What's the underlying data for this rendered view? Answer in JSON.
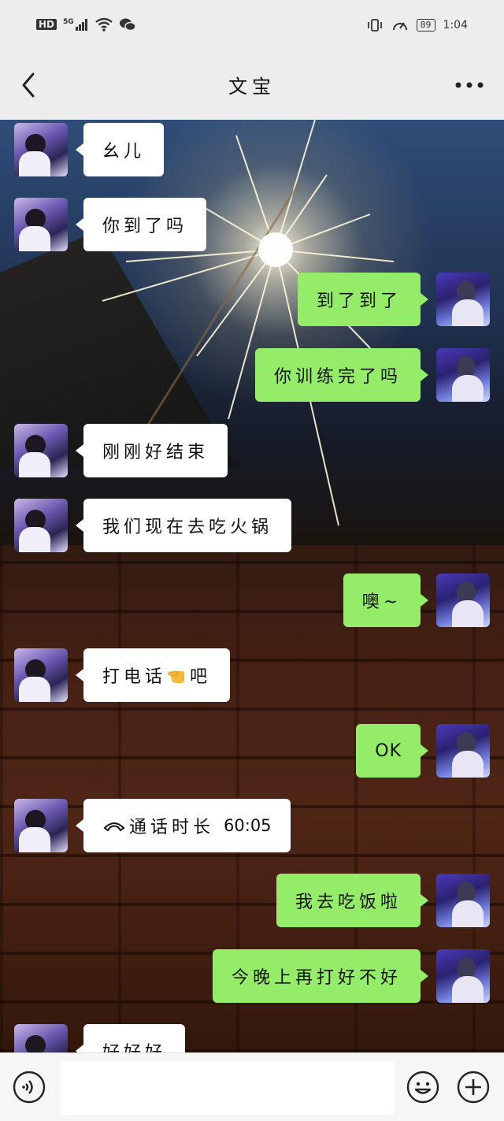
{
  "status_bar": {
    "hd": "HD",
    "network": "5G",
    "battery": "89",
    "time": "1:04"
  },
  "header": {
    "title": "文宝"
  },
  "messages": [
    {
      "side": "left",
      "text": "幺儿"
    },
    {
      "side": "left",
      "text": "你到了吗"
    },
    {
      "side": "right",
      "text": "到了到了"
    },
    {
      "side": "right",
      "text": "你训练完了吗"
    },
    {
      "side": "left",
      "text": "刚刚好结束"
    },
    {
      "side": "left",
      "text": "我们现在去吃火锅"
    },
    {
      "side": "right",
      "text": "噢~"
    },
    {
      "side": "left",
      "text_before": "打电话",
      "text_after": "吧",
      "emoji": "backhand-index-pointing-left"
    },
    {
      "side": "right",
      "text": "OK"
    },
    {
      "side": "left",
      "call_label": "通话时长",
      "call_duration": "60:05",
      "icon": "phone-hangup-icon"
    },
    {
      "side": "right",
      "text": "我去吃饭啦"
    },
    {
      "side": "right",
      "text": "今晚上再打好不好"
    },
    {
      "side": "left",
      "text": "好好好"
    }
  ],
  "input_bar": {
    "placeholder": ""
  },
  "colors": {
    "sent_bubble": "#95ec69",
    "received_bubble": "#ffffff",
    "bar_bg": "#ededed"
  }
}
